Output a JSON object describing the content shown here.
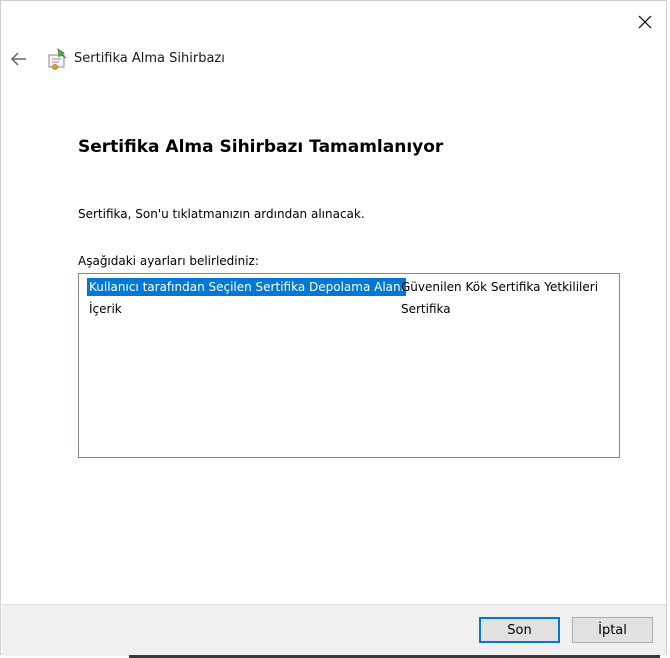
{
  "window": {
    "title": "Sertifika Alma Sihirbazı"
  },
  "page": {
    "heading": "Sertifika Alma Sihirbazı Tamamlanıyor",
    "description": "Sertifika, Son'u tıklatmanızın ardından alınacak.",
    "settings_label": "Aşağıdaki ayarları belirlediniz:"
  },
  "settings": {
    "rows": [
      {
        "name": "Kullanıcı tarafından Seçilen Sertifika Depolama Alanı",
        "value": "Güvenilen Kök Sertifika Yetkilileri",
        "selected": true
      },
      {
        "name": "İçerik",
        "value": "Sertifika",
        "selected": false
      }
    ]
  },
  "buttons": {
    "finish": "Son",
    "cancel": "İptal"
  },
  "icons": {
    "close": "close-icon",
    "back": "back-arrow-icon",
    "wizard": "certificate-wizard-icon"
  },
  "colors": {
    "selection": "#0078d7",
    "footer": "#f0f0f0"
  }
}
